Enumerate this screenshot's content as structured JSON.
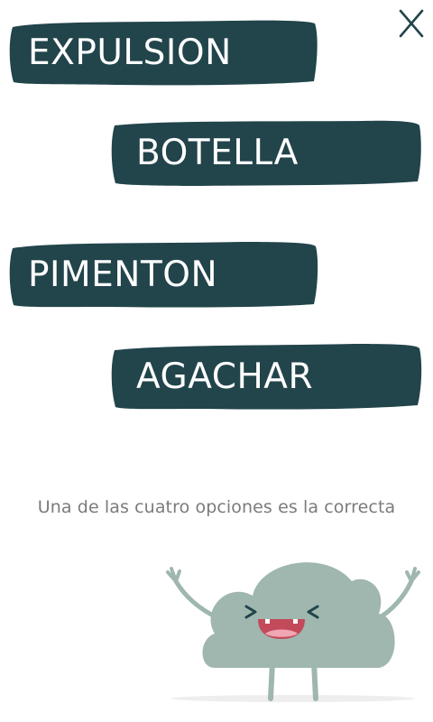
{
  "close": {
    "label": "X",
    "icon": "close-icon"
  },
  "options": [
    {
      "label": "EXPULSION"
    },
    {
      "label": "BOTELLA"
    },
    {
      "label": "PIMENTON"
    },
    {
      "label": "AGACHAR"
    }
  ],
  "hint": "Una de las cuatro opciones es la correcta",
  "mascot": {
    "icon": "happy-cloud-mascot-icon"
  },
  "colors": {
    "button_bg": "#22444b",
    "button_text": "#ffffff",
    "hint_text": "#7b7b7b",
    "cloud": "#9fb7ae",
    "close": "#22444b"
  }
}
